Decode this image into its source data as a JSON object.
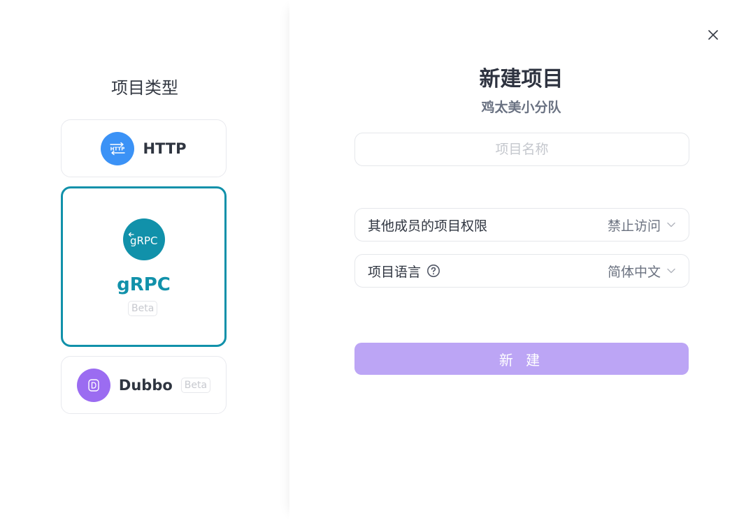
{
  "left": {
    "section_title": "项目类型",
    "types": [
      {
        "name": "HTTP",
        "icon": "http-icon",
        "color": "#3b92f6"
      },
      {
        "name": "gRPC",
        "icon": "grpc-icon",
        "color": "#1191aa",
        "badge": "Beta",
        "selected": true
      },
      {
        "name": "Dubbo",
        "icon": "dubbo-icon",
        "color": "#9b6cf1",
        "badge": "Beta"
      }
    ]
  },
  "dialog": {
    "title": "新建项目",
    "team": "鸡太美小分队",
    "name_placeholder": "项目名称",
    "permission": {
      "label": "其他成员的项目权限",
      "value": "禁止访问"
    },
    "language": {
      "label": "项目语言",
      "value": "简体中文"
    },
    "submit_label": "新 建",
    "accent_color": "#bca5f5"
  },
  "icons": {
    "close": "close-icon",
    "help": "help-circle-icon",
    "chevron": "chevron-down-icon"
  }
}
